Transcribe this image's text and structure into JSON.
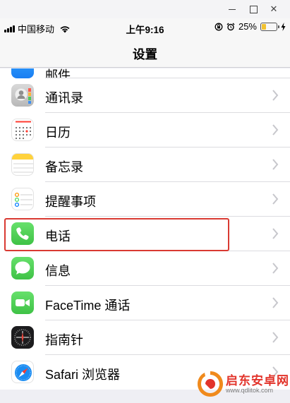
{
  "window": {
    "minimize": "",
    "maximize": "",
    "close": "✕"
  },
  "status_bar": {
    "carrier": "中国移动",
    "time": "上午9:16",
    "battery_percent": "25%",
    "battery_level": 0.25,
    "battery_color": "#f2c230"
  },
  "nav": {
    "title": "设置"
  },
  "list": {
    "items": [
      {
        "label": "邮件",
        "icon": "mail-icon",
        "partial": true
      },
      {
        "label": "通讯录",
        "icon": "contacts-icon"
      },
      {
        "label": "日历",
        "icon": "calendar-icon"
      },
      {
        "label": "备忘录",
        "icon": "notes-icon"
      },
      {
        "label": "提醒事项",
        "icon": "reminders-icon"
      },
      {
        "label": "电话",
        "icon": "phone-icon",
        "highlighted": true
      },
      {
        "label": "信息",
        "icon": "messages-icon"
      },
      {
        "label": "FaceTime 通话",
        "icon": "facetime-icon"
      },
      {
        "label": "指南针",
        "icon": "compass-icon"
      },
      {
        "label": "Safari 浏览器",
        "icon": "safari-icon"
      }
    ]
  },
  "highlight_color": "#d93a32",
  "watermark": {
    "text": "启东安卓网",
    "sub": "www.qdlitok.com"
  }
}
